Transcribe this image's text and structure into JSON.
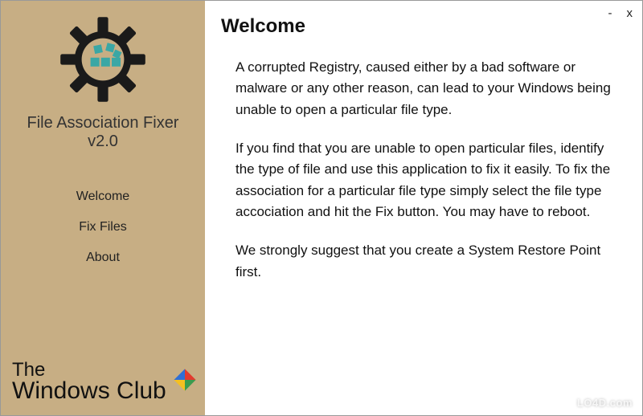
{
  "app": {
    "name": "File Association Fixer",
    "version": "v2.0"
  },
  "nav": {
    "welcome": "Welcome",
    "fix_files": "Fix Files",
    "about": "About"
  },
  "brand": {
    "line1": "The",
    "line2": "Windows Club"
  },
  "content": {
    "heading": "Welcome",
    "para1": "A corrupted Registry, caused either by a bad software or malware or any other reason, can lead to your Windows being unable to open a particular file type.",
    "para2": "If you find that you are unable to open particular files, identify the type of file and use this application to fix it easily. To fix the association for a particular file type simply select the file type accociation and hit the Fix button. You may have to reboot.",
    "para3": "We strongly suggest that you create a System Restore Point first."
  },
  "titlebar": {
    "minimize": "-",
    "close": "x"
  },
  "watermark": "LO4D.com",
  "colors": {
    "sidebar_bg": "#c7ae84",
    "icon_teal": "#3aa7a5",
    "icon_dark": "#1a1a1a"
  }
}
